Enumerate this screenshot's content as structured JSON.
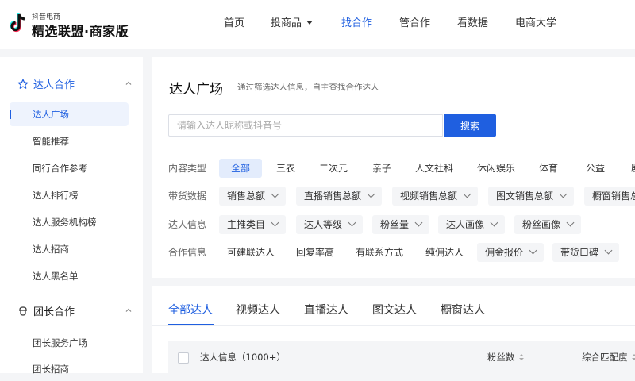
{
  "brand": {
    "small": "抖音电商",
    "name": "精选联盟·商家版"
  },
  "nav": [
    {
      "label": "首页",
      "active": false
    },
    {
      "label": "投商品",
      "active": false,
      "dropdown": true
    },
    {
      "label": "找合作",
      "active": true
    },
    {
      "label": "管合作",
      "active": false
    },
    {
      "label": "看数据",
      "active": false
    },
    {
      "label": "电商大学",
      "active": false
    }
  ],
  "sidebar": {
    "groups": [
      {
        "label": "达人合作",
        "icon": "star-icon",
        "expanded": true,
        "items": [
          "达人广场",
          "智能推荐",
          "同行合作参考",
          "达人排行榜",
          "达人服务机构榜",
          "达人招商",
          "达人黑名单"
        ]
      },
      {
        "label": "团长合作",
        "icon": "leader-icon",
        "expanded": true,
        "items": [
          "团长服务广场",
          "团长招商"
        ]
      }
    ],
    "active_item": "达人广场"
  },
  "page": {
    "title": "达人广场",
    "subtitle": "通过筛选达人信息，自主查找合作达人"
  },
  "search": {
    "placeholder": "请输入达人昵称或抖音号",
    "value": "",
    "button": "搜索"
  },
  "filters": {
    "content_type": {
      "label": "内容类型",
      "options": [
        "全部",
        "三农",
        "二次元",
        "亲子",
        "人文社科",
        "休闲娱乐",
        "体育",
        "公益",
        "剧"
      ],
      "selected": "全部"
    },
    "sales_data": {
      "label": "带货数据",
      "options": [
        "销售总额",
        "直播销售总额",
        "视频销售总额",
        "图文销售总额",
        "橱窗销售总"
      ]
    },
    "talent_info": {
      "label": "达人信息",
      "options": [
        "主推类目",
        "达人等级",
        "粉丝量",
        "达人画像",
        "粉丝画像"
      ]
    },
    "coop_info": {
      "label": "合作信息",
      "options": [
        "可建联达人",
        "回复率高",
        "有联系方式",
        "纯佣达人",
        "佣金报价",
        "带货口碑"
      ]
    }
  },
  "tabs": {
    "items": [
      "全部达人",
      "视频达人",
      "直播达人",
      "图文达人",
      "橱窗达人"
    ],
    "active": "全部达人"
  },
  "table": {
    "columns": [
      "达人信息（1000+）",
      "粉丝数",
      "综合匹配度"
    ]
  },
  "colors": {
    "accent": "#1f5fe0",
    "accent_bg": "#e3ecfc",
    "page_bg": "#f4f5f7"
  }
}
